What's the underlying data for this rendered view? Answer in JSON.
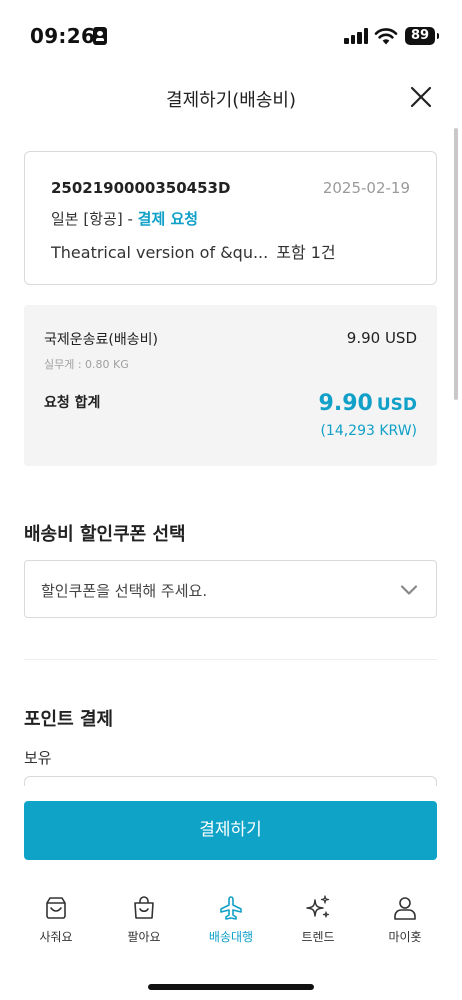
{
  "status_bar": {
    "time": "09:26",
    "battery": "89"
  },
  "header": {
    "title": "결제하기(배송비)"
  },
  "order": {
    "number": "2502190000350453D",
    "date": "2025-02-19",
    "route": "일본 [항공]",
    "separator": "-",
    "status": "결제 요청",
    "item": "Theatrical version of &qu...",
    "count": "포함 1건"
  },
  "fee": {
    "label": "국제운송료(배송비)",
    "value": "9.90 USD",
    "weight": "실무게 : 0.80 KG",
    "total_label": "요청 합계",
    "total_amount": "9.90",
    "total_currency": "USD",
    "total_krw": "(14,293 KRW)"
  },
  "coupon": {
    "title": "배송비 할인쿠폰 선택",
    "placeholder": "할인쿠폰을 선택해 주세요."
  },
  "points": {
    "title": "포인트 결제",
    "hold_label": "보유"
  },
  "pay_button": "결제하기",
  "tabs": [
    {
      "label": "사줘요",
      "icon": "box-icon"
    },
    {
      "label": "팔아요",
      "icon": "shopping-bag-icon"
    },
    {
      "label": "배송대행",
      "icon": "airplane-icon",
      "active": true
    },
    {
      "label": "트렌드",
      "icon": "sparkle-icon"
    },
    {
      "label": "마이홋",
      "icon": "person-icon"
    }
  ],
  "colors": {
    "accent": "#0fa3c8"
  }
}
